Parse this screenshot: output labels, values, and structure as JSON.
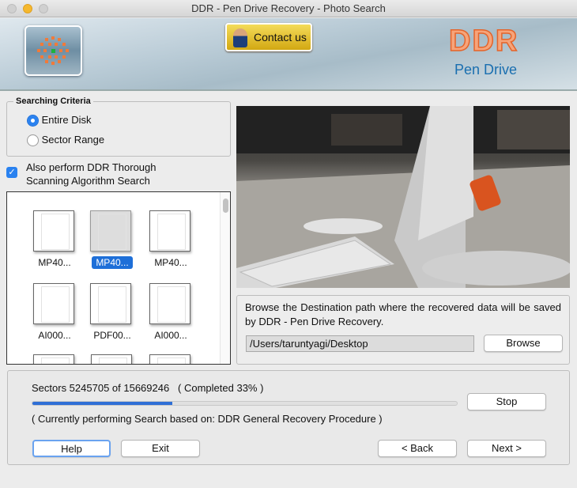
{
  "window": {
    "title": "DDR - Pen Drive Recovery - Photo Search"
  },
  "header": {
    "contact_label": "Contact us",
    "brand": "DDR",
    "product": "Pen Drive"
  },
  "criteria": {
    "title": "Searching Criteria",
    "options": [
      {
        "label": "Entire Disk",
        "selected": true
      },
      {
        "label": "Sector Range",
        "selected": false
      }
    ],
    "thorough_line1": "Also perform DDR Thorough",
    "thorough_line2": "Scanning Algorithm Search",
    "thorough_checked": true
  },
  "files": [
    {
      "name": "MP40...",
      "selected": false
    },
    {
      "name": "MP40...",
      "selected": true
    },
    {
      "name": "MP40...",
      "selected": false
    },
    {
      "name": "AI000...",
      "selected": false
    },
    {
      "name": "PDF00...",
      "selected": false
    },
    {
      "name": "AI000...",
      "selected": false
    }
  ],
  "destination": {
    "text": "Browse the Destination path where the recovered data will be saved by DDR - Pen Drive Recovery.",
    "path": "/Users/taruntyagi/Desktop",
    "browse_label": "Browse"
  },
  "progress": {
    "sectors_text": "Sectors 5245705 of 15669246",
    "completed_text": "( Completed 33% )",
    "percent": 33,
    "status": "( Currently performing Search based on: DDR General Recovery Procedure )",
    "stop_label": "Stop"
  },
  "footer": {
    "help": "Help",
    "exit": "Exit",
    "back": "< Back",
    "next": "Next >"
  },
  "colors": {
    "accent": "#2a82f0",
    "progress_fill": "#2f6fd6",
    "brand_orange": "#e4642a",
    "brand_blue": "#1a6fb0"
  }
}
